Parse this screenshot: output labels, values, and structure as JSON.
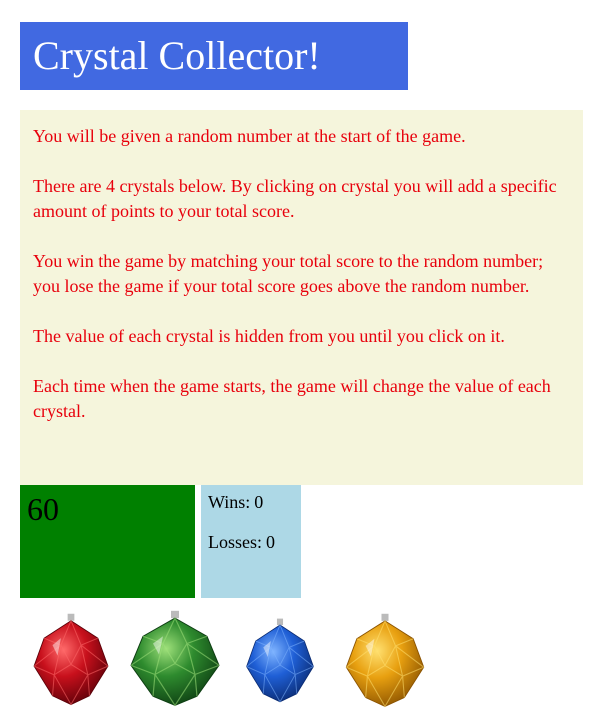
{
  "title": "Crystal Collector!",
  "instructions": [
    "You will be given a random number at the start of the game.",
    "There are 4 crystals below. By clicking on crystal you will add a specific amount of points to your total score.",
    "You win the game by matching your total score to the random number; you lose the game if your total score goes above the random number.",
    "The value of each crystal is hidden from you until you click on it.",
    "Each time when the game starts, the game will change the value of each crystal."
  ],
  "target_number": "60",
  "scoreboard": {
    "wins_label": "Wins:",
    "wins_value": "0",
    "losses_label": "Losses:",
    "losses_value": "0"
  },
  "crystals": [
    {
      "name": "red-crystal-icon",
      "color": "#c8101c",
      "dark": "#5a0008",
      "light": "#ff6a6a"
    },
    {
      "name": "green-crystal-icon",
      "color": "#2e8b2e",
      "dark": "#0d3d12",
      "light": "#9ee07a"
    },
    {
      "name": "blue-crystal-icon",
      "color": "#1f5fd6",
      "dark": "#0a2a70",
      "light": "#7fb4ff"
    },
    {
      "name": "orange-crystal-icon",
      "color": "#e8a010",
      "dark": "#8a5200",
      "light": "#ffe070"
    }
  ]
}
